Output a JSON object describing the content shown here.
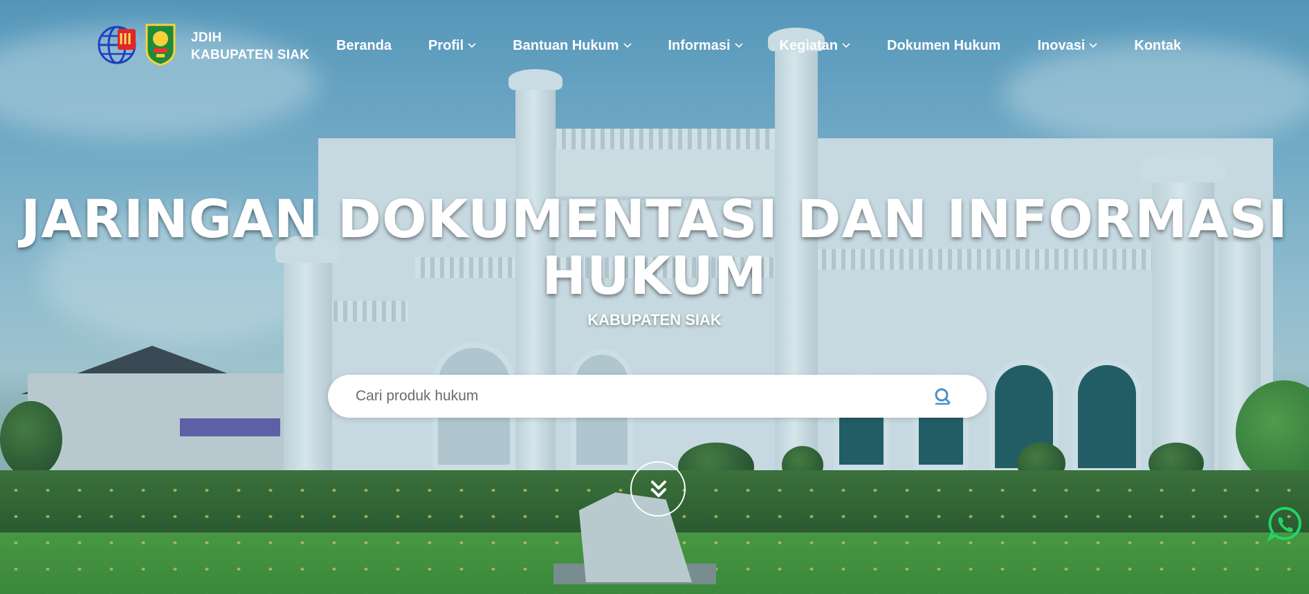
{
  "header": {
    "brand_line1": "JDIH",
    "brand_line2": "KABUPATEN SIAK"
  },
  "nav": {
    "items": [
      {
        "label": "Beranda",
        "has_dropdown": false
      },
      {
        "label": "Profil",
        "has_dropdown": true
      },
      {
        "label": "Bantuan Hukum",
        "has_dropdown": true
      },
      {
        "label": "Informasi",
        "has_dropdown": true
      },
      {
        "label": "Kegiatan",
        "has_dropdown": true
      },
      {
        "label": "Dokumen Hukum",
        "has_dropdown": false
      },
      {
        "label": "Inovasi",
        "has_dropdown": true
      },
      {
        "label": "Kontak",
        "has_dropdown": false
      }
    ]
  },
  "hero": {
    "title_line1": "JARINGAN DOKUMENTASI DAN INFORMASI",
    "title_line2": "HUKUM",
    "subtitle": "KABUPATEN SIAK"
  },
  "search": {
    "placeholder": "Cari produk hukum",
    "value": "",
    "icon": "search-icon"
  },
  "icons": {
    "scroll": "double-chevron-down-icon",
    "chat": "whatsapp-icon",
    "dropdown": "chevron-down-icon"
  },
  "colors": {
    "accent": "#4a90c2",
    "whatsapp": "#25d366",
    "text_on_hero": "#ffffff"
  }
}
